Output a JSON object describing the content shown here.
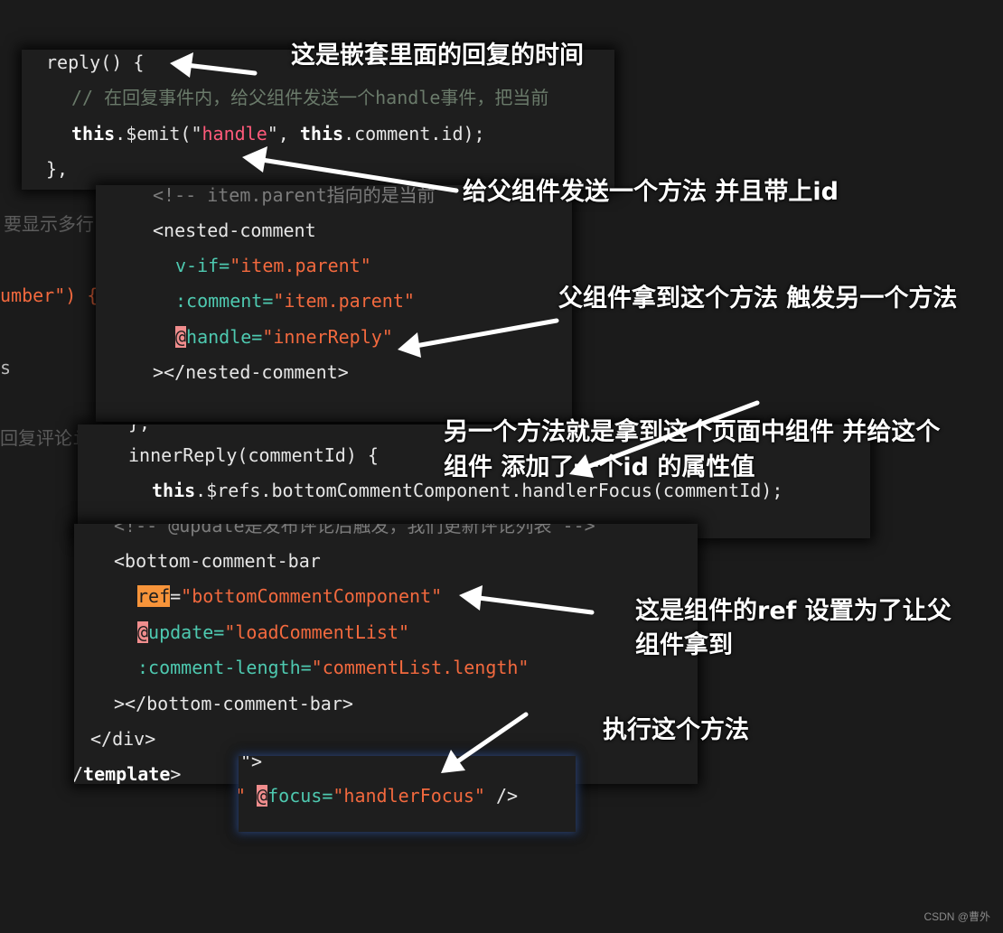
{
  "background_fragments": {
    "f1": "要显示多行",
    "f2": "umber\") {",
    "f3": "s",
    "f4": "回复评论i"
  },
  "panel1": {
    "l1": "reply() {",
    "l2": "// 在回复事件内，给父组件发送一个handle事件，把当前",
    "l3_this": "this",
    "l3_a": ".$emit(",
    "l3_q1": "\"",
    "l3_str": "handle",
    "l3_b": "\", ",
    "l3_this2": "this",
    "l3_c": ".comment.id);",
    "l4": "},"
  },
  "panel2": {
    "l1": "<!-- item.parent指向的是当前",
    "l2": "<nested-comment",
    "l3_attr": "v-if=",
    "l3_val": "\"item.parent\"",
    "l4_attr": ":comment=",
    "l4_val": "\"item.parent\"",
    "l5_at": "@",
    "l5_attr": "handle=",
    "l5_val": "\"innerReply\"",
    "l6": "></nested-comment>"
  },
  "panel3": {
    "l0": "},",
    "l1": "innerReply(commentId) {",
    "l2_this": "this",
    "l2_rest": ".$refs.bottomCommentComponent.handlerFocus(commentId);"
  },
  "panel4": {
    "l0": "<!-- @update是发布评论后触发，我们更新评论列表 -->",
    "l1": "<bottom-comment-bar",
    "l2_ref": "ref",
    "l2_eq": "=",
    "l2_val": "\"bottomCommentComponent\"",
    "l3_at": "@",
    "l3_attr": "update=",
    "l3_val": "\"loadCommentList\"",
    "l4_attr": ":comment-length=",
    "l4_val": "\"commentList.length\"",
    "l5": "></bottom-comment-bar>",
    "l6": "</div>",
    "l7_a": "/",
    "l7_b": "template",
    "l7_c": ">"
  },
  "panel5": {
    "l0": "\">",
    "l1_q": "\"",
    "l1_at": "@",
    "l1_attr": "focus=",
    "l1_val": "\"handlerFocus\"",
    "l1_end": " />"
  },
  "annotations": {
    "a1": "这是嵌套里面的回复的时间",
    "a2": "给父组件发送一个方法 并且带上id",
    "a3": "父组件拿到这个方法 触发另一个方法",
    "a4_l1": "另一个方法就是拿到这个页面中组件 并给这个",
    "a4_l2": "组件 添加了一个id 的属性值",
    "a5_l1": "这是组件的ref  设置为了让父",
    "a5_l2": "组件拿到",
    "a6": "执行这个方法"
  },
  "watermark": "CSDN @曹外",
  "colors": {
    "background": "#1b1b1b",
    "panel": "#1e1e1e",
    "string": "#f2693e",
    "attribute": "#4ec9b0",
    "ref_highlight": "#f7943a",
    "at_highlight": "#f08d8d",
    "arrow": "#ffffff"
  }
}
